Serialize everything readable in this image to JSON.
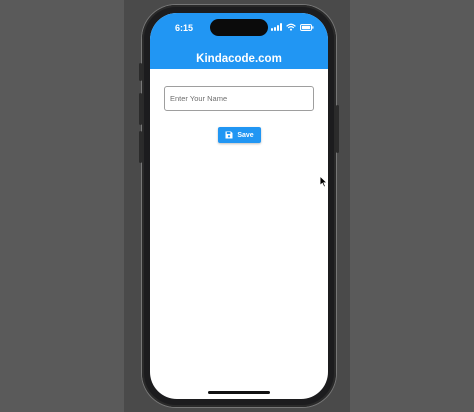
{
  "status_bar": {
    "time": "6:15",
    "icons": [
      "signal-icon",
      "wifi-icon",
      "battery-icon"
    ]
  },
  "app_bar": {
    "title": "Kindacode.com",
    "background_color": "#2196f3"
  },
  "form": {
    "name_input": {
      "value": "",
      "placeholder": "Enter Your Name"
    },
    "save_button": {
      "label": "Save",
      "icon": "save-icon",
      "color": "#2196f3"
    }
  },
  "pointer": {
    "icon": "mouse-cursor-icon"
  }
}
